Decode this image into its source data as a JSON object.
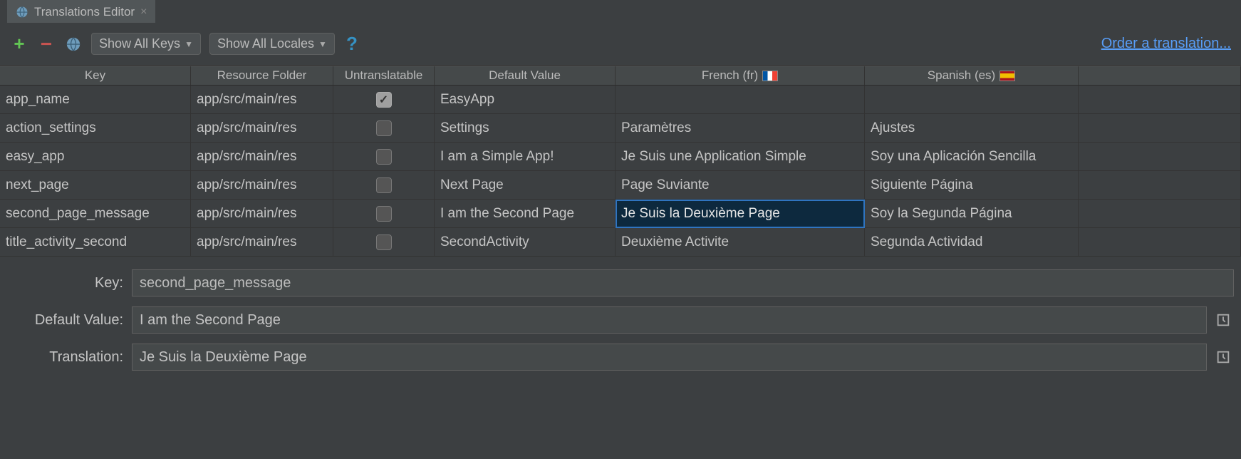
{
  "tab": {
    "title": "Translations Editor"
  },
  "toolbar": {
    "keys_label": "Show All Keys",
    "locales_label": "Show All Locales",
    "order_link": "Order a translation..."
  },
  "columns": {
    "key": "Key",
    "resource": "Resource Folder",
    "untranslatable": "Untranslatable",
    "default": "Default Value",
    "french": "French (fr)",
    "spanish": "Spanish (es)"
  },
  "rows": [
    {
      "key": "app_name",
      "res": "app/src/main/res",
      "unt": true,
      "def": "EasyApp",
      "fr": "",
      "es": ""
    },
    {
      "key": "action_settings",
      "res": "app/src/main/res",
      "unt": false,
      "def": "Settings",
      "fr": "Paramètres",
      "es": "Ajustes"
    },
    {
      "key": "easy_app",
      "res": "app/src/main/res",
      "unt": false,
      "def": "I am a Simple App!",
      "fr": "Je Suis une Application Simple",
      "es": "Soy una Aplicación Sencilla"
    },
    {
      "key": "next_page",
      "res": "app/src/main/res",
      "unt": false,
      "def": "Next Page",
      "fr": "Page Suviante",
      "es": "Siguiente Página"
    },
    {
      "key": "second_page_message",
      "res": "app/src/main/res",
      "unt": false,
      "def": "I am the Second Page",
      "fr": "Je Suis la Deuxième Page",
      "es": "Soy la Segunda Página"
    },
    {
      "key": "title_activity_second",
      "res": "app/src/main/res",
      "unt": false,
      "def": "SecondActivity",
      "fr": "Deuxième Activite",
      "es": "Segunda Actividad"
    }
  ],
  "selected": {
    "row": 4,
    "col": "fr"
  },
  "detail": {
    "labels": {
      "key": "Key:",
      "default": "Default Value:",
      "translation": "Translation:"
    },
    "key": "second_page_message",
    "default": "I am the Second Page",
    "translation": "Je Suis la Deuxième Page"
  }
}
